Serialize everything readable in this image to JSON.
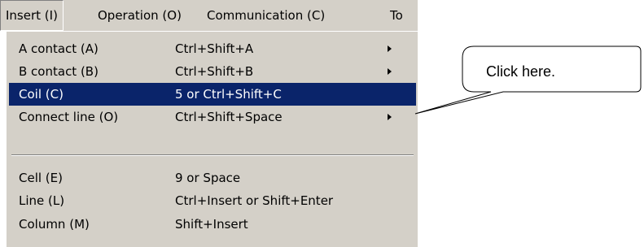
{
  "menubar": {
    "items": [
      {
        "label": "Insert (I)"
      },
      {
        "label": "Operation (O)"
      },
      {
        "label": "Communication (C)"
      },
      {
        "label": "To"
      }
    ]
  },
  "dropdown": {
    "items": [
      {
        "label": "A contact (A)",
        "shortcut": "Ctrl+Shift+A",
        "has_submenu": true
      },
      {
        "label": "B contact (B)",
        "shortcut": "Ctrl+Shift+B",
        "has_submenu": true
      },
      {
        "label": "Coil (C)",
        "shortcut": "5 or Ctrl+Shift+C",
        "selected": true
      },
      {
        "label": "Connect line (O)",
        "shortcut": "Ctrl+Shift+Space",
        "has_submenu": true
      },
      {
        "label": "Cell (E)",
        "shortcut": "9 or Space"
      },
      {
        "label": "Line (L)",
        "shortcut": "Ctrl+Insert or Shift+Enter"
      },
      {
        "label": "Column (M)",
        "shortcut": "Shift+Insert"
      }
    ]
  },
  "callout": {
    "text": "Click here."
  },
  "colors": {
    "menu_background": "#d4d0c8",
    "selection": "#0a246a",
    "selection_text": "#ffffff"
  },
  "icons": {
    "submenu": "submenu-arrow-icon"
  }
}
